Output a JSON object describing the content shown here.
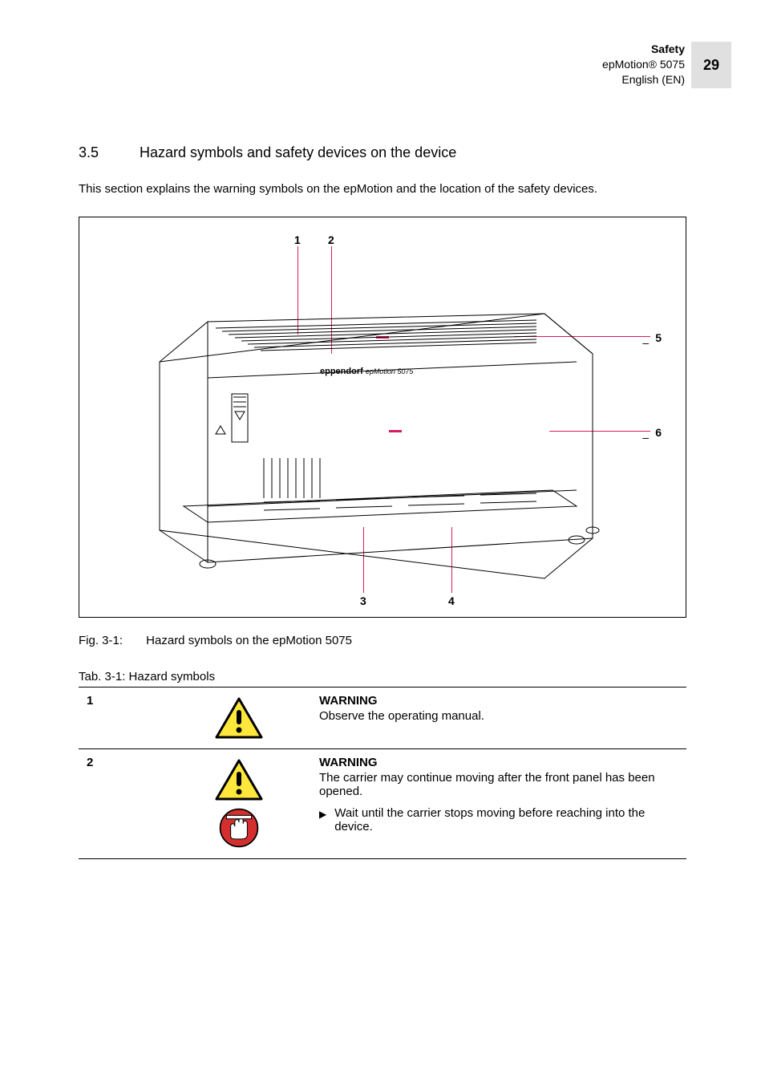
{
  "header": {
    "line1": "Safety",
    "line2": "epMotion® 5075",
    "line3": "English (EN)",
    "page_number": "29"
  },
  "section": {
    "number": "3.5",
    "title": "Hazard symbols and safety devices on the device",
    "intro": "This section explains the warning symbols on the epMotion and the location of the safety devices."
  },
  "figure": {
    "callouts": {
      "1": "1",
      "2": "2",
      "3": "3",
      "4": "4",
      "5": "5",
      "6": "6"
    },
    "brand_bold": "eppendorf",
    "brand_italic": "epMotion 5075",
    "caption_label": "Fig. 3-1:",
    "caption_text": "Hazard symbols on the epMotion 5075"
  },
  "table": {
    "caption": "Tab. 3-1: Hazard symbols",
    "rows": [
      {
        "num": "1",
        "icons": [
          "warning-triangle"
        ],
        "title": "WARNING",
        "body": "Observe the operating manual.",
        "bullet": null
      },
      {
        "num": "2",
        "icons": [
          "warning-triangle",
          "hand-crush"
        ],
        "title": "WARNING",
        "body": "The carrier may continue moving after the front panel has been opened.",
        "bullet": "Wait until the carrier stops moving before reaching into the device."
      }
    ]
  }
}
